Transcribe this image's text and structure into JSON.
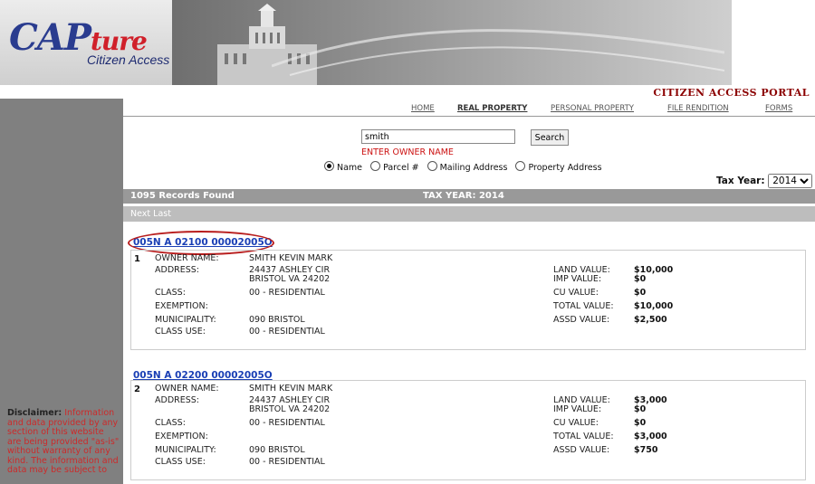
{
  "banner": {
    "logo_main": "CAP",
    "logo_accent": "ture",
    "logo_sub": "Citizen Access"
  },
  "portal_title": "CITIZEN ACCESS PORTAL",
  "nav": [
    "HOME",
    "REAL PROPERTY",
    "PERSONAL PROPERTY",
    "FILE RENDITION",
    "FORMS"
  ],
  "search": {
    "value": "smith",
    "button": "Search",
    "hint": "ENTER OWNER NAME",
    "options": [
      "Name",
      "Parcel #",
      "Mailing Address",
      "Property Address"
    ],
    "selected": "Name"
  },
  "tax_year": {
    "label": "Tax Year:",
    "value": "2014"
  },
  "results": {
    "count": "1095 Records Found",
    "tax_year": "TAX YEAR: 2014",
    "paging": "Next Last"
  },
  "labels": {
    "owner": "OWNER NAME:",
    "address": "ADDRESS:",
    "class": "CLASS:",
    "exemption": "EXEMPTION:",
    "municipality": "MUNICIPALITY:",
    "class_use": "CLASS USE:",
    "land": "LAND VALUE:",
    "imp": "IMP VALUE:",
    "cu": "CU VALUE:",
    "total": "TOTAL VALUE:",
    "assd": "ASSD VALUE:"
  },
  "records": [
    {
      "parcel": "005N A 02100 00002005O",
      "n": "1",
      "owner": "SMITH KEVIN MARK",
      "addr1": "24437 ASHLEY CIR",
      "addr2": "BRISTOL VA 24202",
      "class": "00 - RESIDENTIAL",
      "exemption": "",
      "municipality": "090 BRISTOL",
      "class_use": "00 - RESIDENTIAL",
      "land": "$10,000",
      "imp": "$0",
      "cu": "$0",
      "total": "$10,000",
      "assd": "$2,500"
    },
    {
      "parcel": "005N A 02200 00002005O",
      "n": "2",
      "owner": "SMITH KEVIN MARK",
      "addr1": "24437 ASHLEY CIR",
      "addr2": "BRISTOL VA 24202",
      "class": "00 - RESIDENTIAL",
      "exemption": "",
      "municipality": "090 BRISTOL",
      "class_use": "00 - RESIDENTIAL",
      "land": "$3,000",
      "imp": "$0",
      "cu": "$0",
      "total": "$3,000",
      "assd": "$750"
    }
  ],
  "disclaimer": {
    "title": "Disclaimer:",
    "text": " Information and data provided by any section of this website are being provided \"as-is\" without warranty of any kind. The information and data may be subject to"
  },
  "colors": {
    "portal": "#8b0000",
    "link": "#1a3fb5",
    "sidebar": "#808080"
  }
}
